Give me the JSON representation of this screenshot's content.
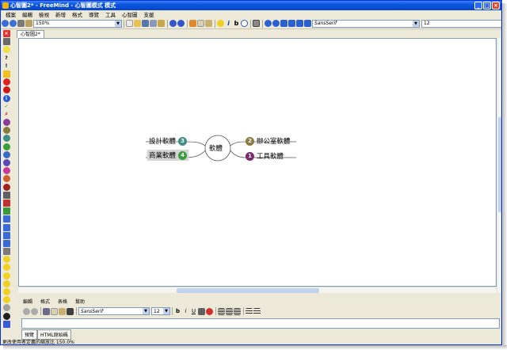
{
  "window": {
    "title": "心智圖2* - FreeMind - 心智圖模式 模式",
    "minimize": "_",
    "maximize": "□",
    "close": "×"
  },
  "menu": [
    "檔案",
    "編輯",
    "檢視",
    "新增",
    "格式",
    "導覽",
    "工具",
    "心智圖",
    "支援"
  ],
  "toolbar": {
    "zoom": "150%",
    "font": "SansSerif",
    "size": "12"
  },
  "tab": "心智圖2*",
  "map": {
    "root": "軟體",
    "nodes": [
      {
        "label": "設計軟體",
        "badge": "3",
        "color": "#3f8f86"
      },
      {
        "label": "商業軟體",
        "badge": "4",
        "color": "#3c9d3c"
      },
      {
        "label": "辦公室軟體",
        "badge": "2",
        "color": "#8a7a40"
      },
      {
        "label": "工具軟體",
        "badge": "1",
        "color": "#7a2a6a"
      }
    ]
  },
  "editor": {
    "menu": [
      "編輯",
      "格式",
      "表格",
      "幫助"
    ],
    "font": "SansSerif",
    "size": "12",
    "bold": "b",
    "italic": "i",
    "underline": "U",
    "tabs": [
      "預覽",
      "HTML原始碼"
    ]
  },
  "status": "更改使用者定義的縮放比 150.0%",
  "colors": {
    "titlebar": "#0a56e0",
    "chrome": "#ece9d8",
    "selected_node_bg": "#d4d4d4"
  }
}
